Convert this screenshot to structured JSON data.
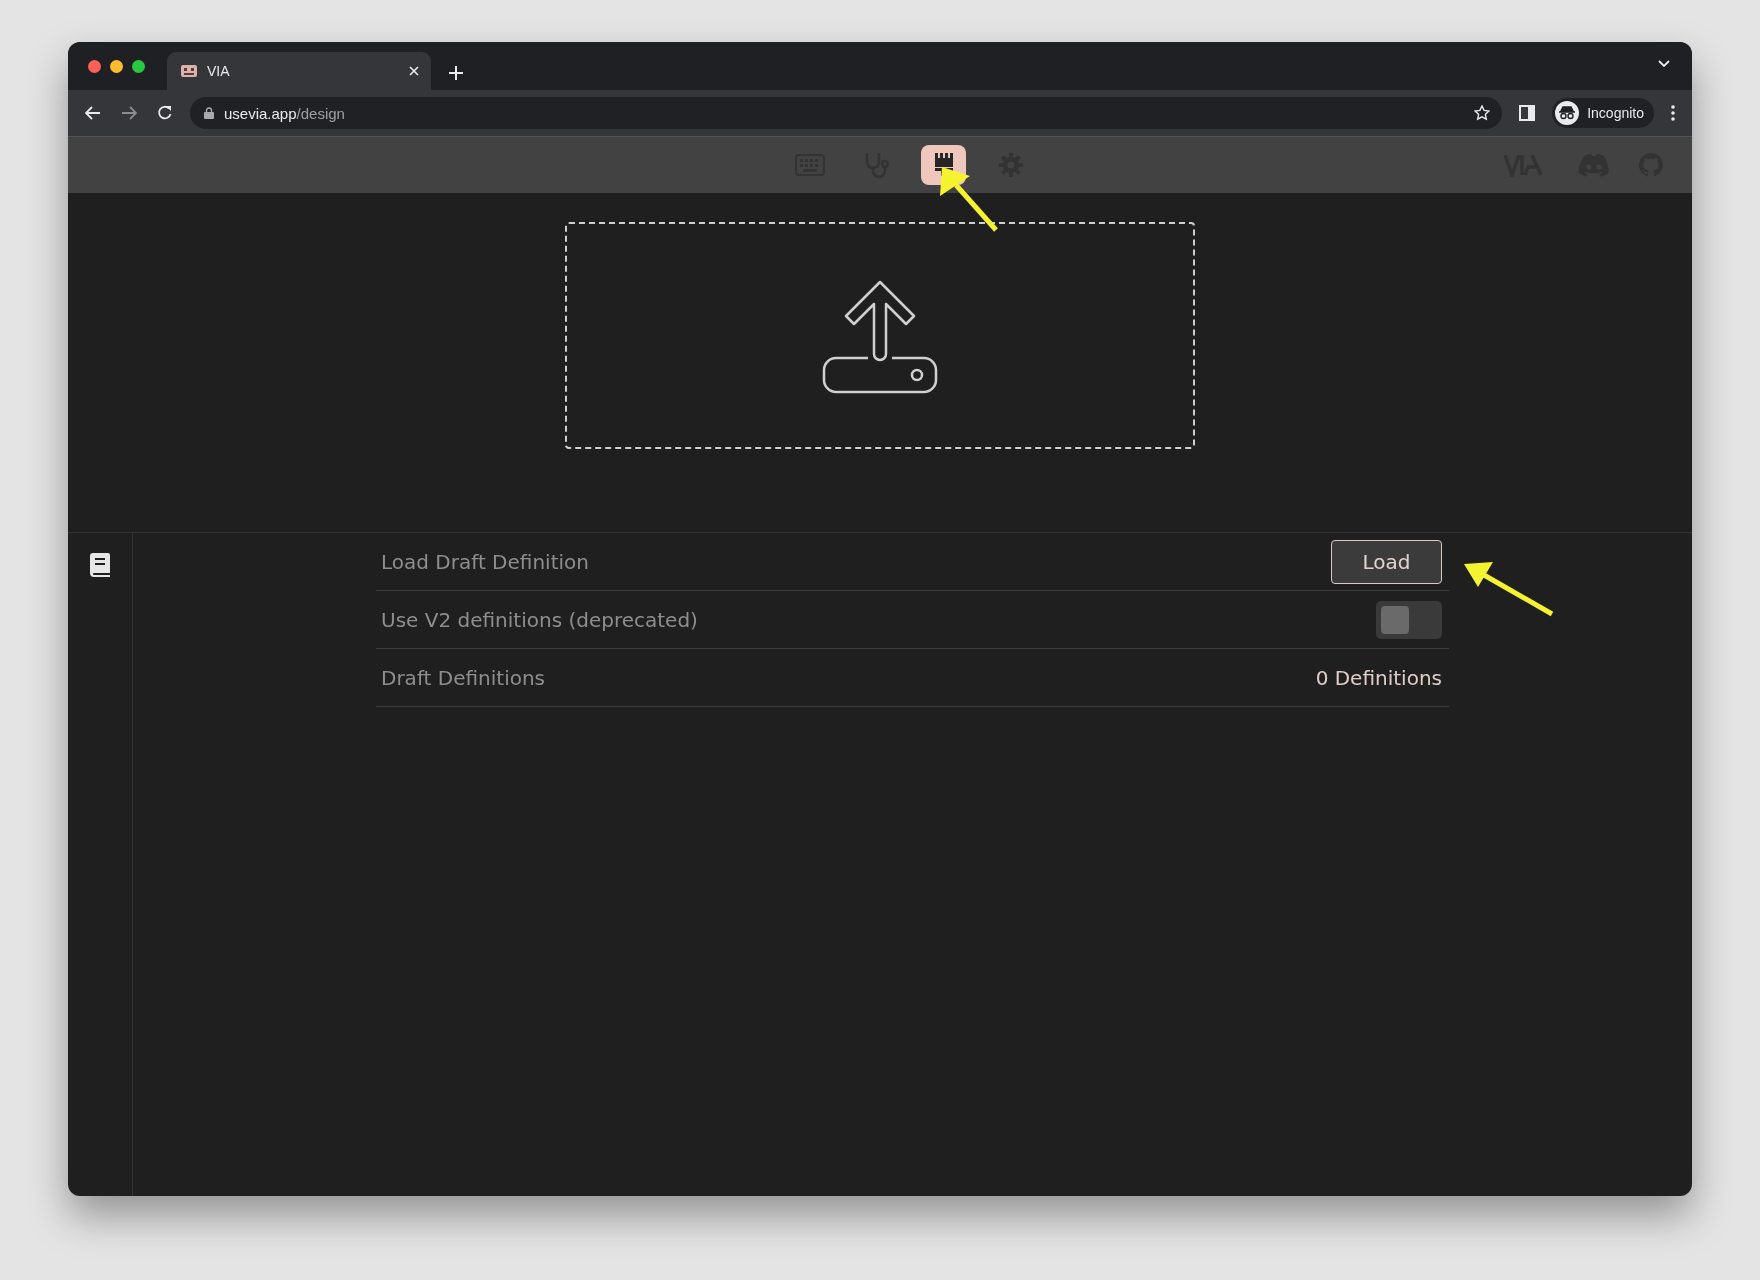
{
  "browser": {
    "tab": {
      "title": "VIA",
      "selected": true
    },
    "url_host": "usevia.app",
    "url_path": "/design",
    "profile_label": "Incognito"
  },
  "app_nav": {
    "items": [
      {
        "kind": "keyboard",
        "selected": false
      },
      {
        "kind": "stethoscope",
        "selected": false
      },
      {
        "kind": "paintbrush",
        "selected": true
      },
      {
        "kind": "gear",
        "selected": false
      }
    ],
    "links": [
      {
        "kind": "via-logo"
      },
      {
        "kind": "discord"
      },
      {
        "kind": "github"
      }
    ]
  },
  "settings": [
    {
      "kind": "button",
      "label": "Load Draft Definition",
      "button": "Load"
    },
    {
      "kind": "toggle",
      "label": "Use V2 definitions (deprecated)",
      "on": false
    },
    {
      "kind": "text",
      "label": "Draft Definitions",
      "value": "0 Definitions"
    }
  ]
}
